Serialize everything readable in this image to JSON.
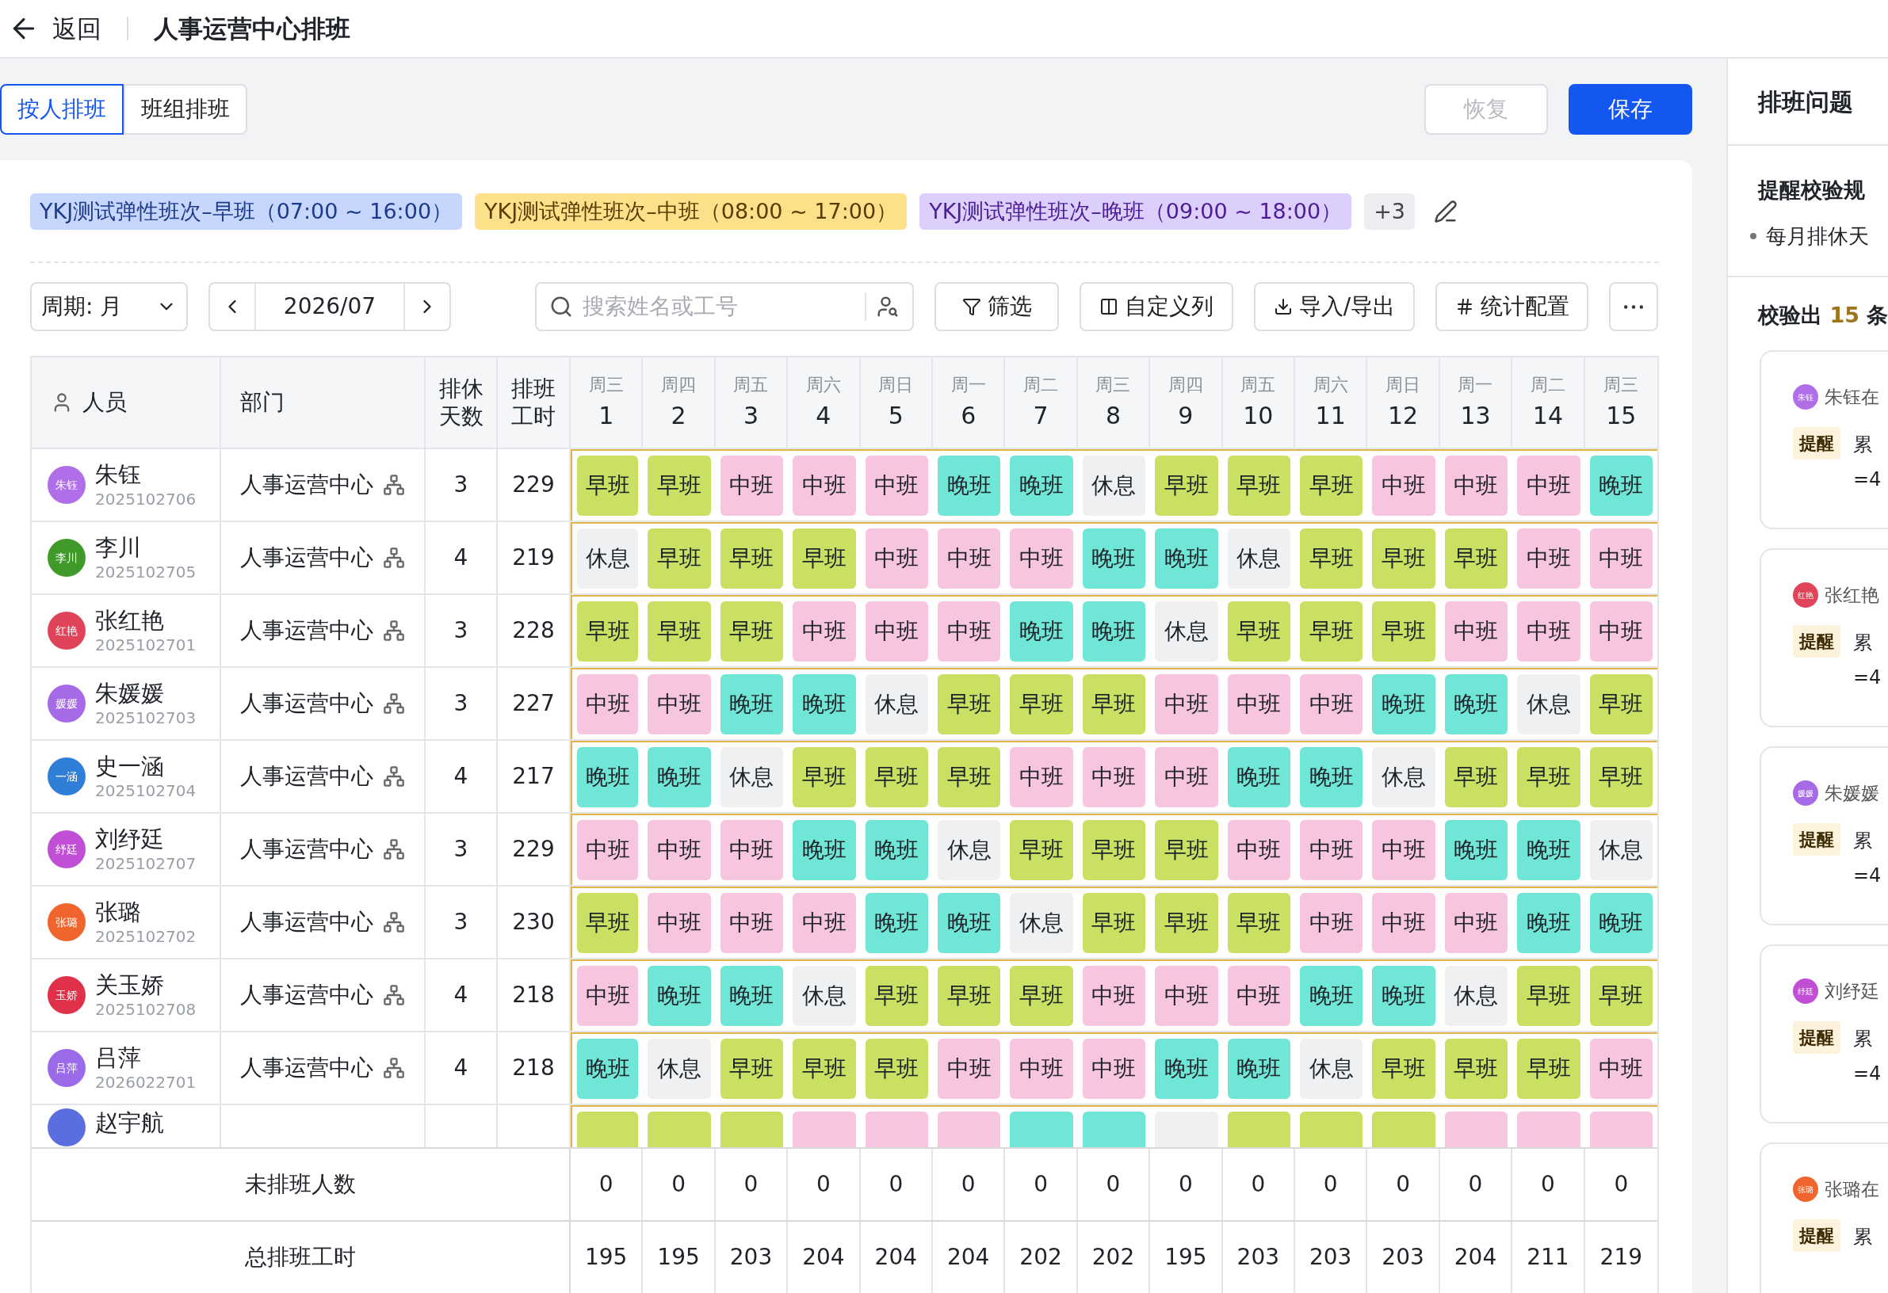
{
  "header": {
    "back": "返回",
    "title": "人事运营中心排班"
  },
  "tabs": [
    {
      "label": "按人排班",
      "selected": true
    },
    {
      "label": "班组排班",
      "selected": false
    }
  ],
  "actions": {
    "restore": {
      "label": "恢复",
      "disabled": true
    },
    "save": "保存"
  },
  "legend": [
    {
      "label": "YKJ测试弹性班次–早班（07:00 ~ 16:00）",
      "color": "#c6d6fd"
    },
    {
      "label": "YKJ测试弹性班次–中班（08:00 ~ 17:00）",
      "color": "#fce08a"
    },
    {
      "label": "YKJ测试弹性班次–晚班（09:00 ~ 18:00）",
      "color": "#dccffc"
    }
  ],
  "legend_more": "+3",
  "toolbar": {
    "period": "周期: 月",
    "month": "2026/07",
    "search_placeholder": "搜索姓名或工号",
    "filter": "筛选",
    "columns": "自定义列",
    "import_export": "导入/导出",
    "stats": "统计配置"
  },
  "table": {
    "columns": [
      "人员",
      "部门",
      "排休天数",
      "排班工时"
    ],
    "days": [
      {
        "weekday": "周三",
        "day": "1"
      },
      {
        "weekday": "周四",
        "day": "2"
      },
      {
        "weekday": "周五",
        "day": "3"
      },
      {
        "weekday": "周六",
        "day": "4"
      },
      {
        "weekday": "周日",
        "day": "5"
      },
      {
        "weekday": "周一",
        "day": "6"
      },
      {
        "weekday": "周二",
        "day": "7"
      },
      {
        "weekday": "周三",
        "day": "8"
      },
      {
        "weekday": "周四",
        "day": "9"
      },
      {
        "weekday": "周五",
        "day": "10"
      },
      {
        "weekday": "周六",
        "day": "11"
      },
      {
        "weekday": "周日",
        "day": "12"
      },
      {
        "weekday": "周一",
        "day": "13"
      },
      {
        "weekday": "周二",
        "day": "14"
      },
      {
        "weekday": "周三",
        "day": "15"
      }
    ],
    "rows": [
      {
        "name": "朱钰",
        "avatar": "朱钰",
        "color": "#b06ee8",
        "id": "2025102706",
        "dept": "人事运营中心",
        "rest": "3",
        "hours": "229",
        "shifts": [
          {
            "t": "早班",
            "kind": "early"
          },
          {
            "t": "早班",
            "kind": "early"
          },
          {
            "t": "中班",
            "kind": "mid"
          },
          {
            "t": "中班",
            "kind": "mid"
          },
          {
            "t": "中班",
            "kind": "mid"
          },
          {
            "t": "晚班",
            "kind": "late"
          },
          {
            "t": "晚班",
            "kind": "late"
          },
          {
            "t": "休息",
            "kind": "rest"
          },
          {
            "t": "早班",
            "kind": "early"
          },
          {
            "t": "早班",
            "kind": "early"
          },
          {
            "t": "早班",
            "kind": "early"
          },
          {
            "t": "中班",
            "kind": "mid"
          },
          {
            "t": "中班",
            "kind": "mid"
          },
          {
            "t": "中班",
            "kind": "mid"
          },
          {
            "t": "晚班",
            "kind": "late"
          }
        ]
      },
      {
        "name": "李川",
        "avatar": "李川",
        "color": "#3f9a2a",
        "id": "2025102705",
        "dept": "人事运营中心",
        "rest": "4",
        "hours": "219",
        "shifts": [
          {
            "t": "休息",
            "kind": "rest"
          },
          {
            "t": "早班",
            "kind": "early"
          },
          {
            "t": "早班",
            "kind": "early"
          },
          {
            "t": "早班",
            "kind": "early"
          },
          {
            "t": "中班",
            "kind": "mid"
          },
          {
            "t": "中班",
            "kind": "mid"
          },
          {
            "t": "中班",
            "kind": "mid"
          },
          {
            "t": "晚班",
            "kind": "late"
          },
          {
            "t": "晚班",
            "kind": "late"
          },
          {
            "t": "休息",
            "kind": "rest"
          },
          {
            "t": "早班",
            "kind": "early"
          },
          {
            "t": "早班",
            "kind": "early"
          },
          {
            "t": "早班",
            "kind": "early"
          },
          {
            "t": "中班",
            "kind": "mid"
          },
          {
            "t": "中班",
            "kind": "mid"
          }
        ]
      },
      {
        "name": "张红艳",
        "avatar": "红艳",
        "color": "#e0445a",
        "id": "2025102701",
        "dept": "人事运营中心",
        "rest": "3",
        "hours": "228",
        "shifts": [
          {
            "t": "早班",
            "kind": "early"
          },
          {
            "t": "早班",
            "kind": "early"
          },
          {
            "t": "早班",
            "kind": "early"
          },
          {
            "t": "中班",
            "kind": "mid"
          },
          {
            "t": "中班",
            "kind": "mid"
          },
          {
            "t": "中班",
            "kind": "mid"
          },
          {
            "t": "晚班",
            "kind": "late"
          },
          {
            "t": "晚班",
            "kind": "late"
          },
          {
            "t": "休息",
            "kind": "rest"
          },
          {
            "t": "早班",
            "kind": "early"
          },
          {
            "t": "早班",
            "kind": "early"
          },
          {
            "t": "早班",
            "kind": "early"
          },
          {
            "t": "中班",
            "kind": "mid"
          },
          {
            "t": "中班",
            "kind": "mid"
          },
          {
            "t": "中班",
            "kind": "mid"
          }
        ]
      },
      {
        "name": "朱媛媛",
        "avatar": "媛媛",
        "color": "#a66ae6",
        "id": "2025102703",
        "dept": "人事运营中心",
        "rest": "3",
        "hours": "227",
        "shifts": [
          {
            "t": "中班",
            "kind": "mid"
          },
          {
            "t": "中班",
            "kind": "mid"
          },
          {
            "t": "晚班",
            "kind": "late"
          },
          {
            "t": "晚班",
            "kind": "late"
          },
          {
            "t": "休息",
            "kind": "rest"
          },
          {
            "t": "早班",
            "kind": "early"
          },
          {
            "t": "早班",
            "kind": "early"
          },
          {
            "t": "早班",
            "kind": "early"
          },
          {
            "t": "中班",
            "kind": "mid"
          },
          {
            "t": "中班",
            "kind": "mid"
          },
          {
            "t": "中班",
            "kind": "mid"
          },
          {
            "t": "晚班",
            "kind": "late"
          },
          {
            "t": "晚班",
            "kind": "late"
          },
          {
            "t": "休息",
            "kind": "rest"
          },
          {
            "t": "早班",
            "kind": "early"
          }
        ]
      },
      {
        "name": "史一涵",
        "avatar": "一涵",
        "color": "#2f7fd8",
        "id": "2025102704",
        "dept": "人事运营中心",
        "rest": "4",
        "hours": "217",
        "shifts": [
          {
            "t": "晚班",
            "kind": "late"
          },
          {
            "t": "晚班",
            "kind": "late"
          },
          {
            "t": "休息",
            "kind": "rest"
          },
          {
            "t": "早班",
            "kind": "early"
          },
          {
            "t": "早班",
            "kind": "early"
          },
          {
            "t": "早班",
            "kind": "early"
          },
          {
            "t": "中班",
            "kind": "mid"
          },
          {
            "t": "中班",
            "kind": "mid"
          },
          {
            "t": "中班",
            "kind": "mid"
          },
          {
            "t": "晚班",
            "kind": "late"
          },
          {
            "t": "晚班",
            "kind": "late"
          },
          {
            "t": "休息",
            "kind": "rest"
          },
          {
            "t": "早班",
            "kind": "early"
          },
          {
            "t": "早班",
            "kind": "early"
          },
          {
            "t": "早班",
            "kind": "early"
          }
        ]
      },
      {
        "name": "刘纾廷",
        "avatar": "纾廷",
        "color": "#c04fd6",
        "id": "2025102707",
        "dept": "人事运营中心",
        "rest": "3",
        "hours": "229",
        "shifts": [
          {
            "t": "中班",
            "kind": "mid"
          },
          {
            "t": "中班",
            "kind": "mid"
          },
          {
            "t": "中班",
            "kind": "mid"
          },
          {
            "t": "晚班",
            "kind": "late"
          },
          {
            "t": "晚班",
            "kind": "late"
          },
          {
            "t": "休息",
            "kind": "rest"
          },
          {
            "t": "早班",
            "kind": "early"
          },
          {
            "t": "早班",
            "kind": "early"
          },
          {
            "t": "早班",
            "kind": "early"
          },
          {
            "t": "中班",
            "kind": "mid"
          },
          {
            "t": "中班",
            "kind": "mid"
          },
          {
            "t": "中班",
            "kind": "mid"
          },
          {
            "t": "晚班",
            "kind": "late"
          },
          {
            "t": "晚班",
            "kind": "late"
          },
          {
            "t": "休息",
            "kind": "rest"
          }
        ]
      },
      {
        "name": "张璐",
        "avatar": "张璐",
        "color": "#f0652e",
        "id": "2025102702",
        "dept": "人事运营中心",
        "rest": "3",
        "hours": "230",
        "shifts": [
          {
            "t": "早班",
            "kind": "early"
          },
          {
            "t": "中班",
            "kind": "mid"
          },
          {
            "t": "中班",
            "kind": "mid"
          },
          {
            "t": "中班",
            "kind": "mid"
          },
          {
            "t": "晚班",
            "kind": "late"
          },
          {
            "t": "晚班",
            "kind": "late"
          },
          {
            "t": "休息",
            "kind": "rest"
          },
          {
            "t": "早班",
            "kind": "early"
          },
          {
            "t": "早班",
            "kind": "early"
          },
          {
            "t": "早班",
            "kind": "early"
          },
          {
            "t": "中班",
            "kind": "mid"
          },
          {
            "t": "中班",
            "kind": "mid"
          },
          {
            "t": "中班",
            "kind": "mid"
          },
          {
            "t": "晚班",
            "kind": "late"
          },
          {
            "t": "晚班",
            "kind": "late"
          }
        ]
      },
      {
        "name": "关玉娇",
        "avatar": "玉娇",
        "color": "#e0304a",
        "id": "2025102708",
        "dept": "人事运营中心",
        "rest": "4",
        "hours": "218",
        "shifts": [
          {
            "t": "中班",
            "kind": "mid"
          },
          {
            "t": "晚班",
            "kind": "late"
          },
          {
            "t": "晚班",
            "kind": "late"
          },
          {
            "t": "休息",
            "kind": "rest"
          },
          {
            "t": "早班",
            "kind": "early"
          },
          {
            "t": "早班",
            "kind": "early"
          },
          {
            "t": "早班",
            "kind": "early"
          },
          {
            "t": "中班",
            "kind": "mid"
          },
          {
            "t": "中班",
            "kind": "mid"
          },
          {
            "t": "中班",
            "kind": "mid"
          },
          {
            "t": "晚班",
            "kind": "late"
          },
          {
            "t": "晚班",
            "kind": "late"
          },
          {
            "t": "休息",
            "kind": "rest"
          },
          {
            "t": "早班",
            "kind": "early"
          },
          {
            "t": "早班",
            "kind": "early"
          }
        ]
      },
      {
        "name": "吕萍",
        "avatar": "吕萍",
        "color": "#9a6ae8",
        "id": "2026022701",
        "dept": "人事运营中心",
        "rest": "4",
        "hours": "218",
        "shifts": [
          {
            "t": "晚班",
            "kind": "late"
          },
          {
            "t": "休息",
            "kind": "rest"
          },
          {
            "t": "早班",
            "kind": "early"
          },
          {
            "t": "早班",
            "kind": "early"
          },
          {
            "t": "早班",
            "kind": "early"
          },
          {
            "t": "中班",
            "kind": "mid"
          },
          {
            "t": "中班",
            "kind": "mid"
          },
          {
            "t": "中班",
            "kind": "mid"
          },
          {
            "t": "晚班",
            "kind": "late"
          },
          {
            "t": "晚班",
            "kind": "late"
          },
          {
            "t": "休息",
            "kind": "rest"
          },
          {
            "t": "早班",
            "kind": "early"
          },
          {
            "t": "早班",
            "kind": "early"
          },
          {
            "t": "早班",
            "kind": "early"
          },
          {
            "t": "中班",
            "kind": "mid"
          }
        ]
      },
      {
        "name": "赵宇航",
        "color": "#5b6ee0",
        "shifts": [
          {
            "kind": "early"
          },
          {
            "kind": "early"
          },
          {
            "kind": "early"
          },
          {
            "kind": "mid"
          },
          {
            "kind": "mid"
          },
          {
            "kind": "mid"
          },
          {
            "kind": "late"
          },
          {
            "kind": "late"
          },
          {
            "kind": "rest"
          },
          {
            "kind": "early"
          },
          {
            "kind": "early"
          },
          {
            "kind": "early"
          },
          {
            "kind": "mid"
          },
          {
            "kind": "mid"
          },
          {
            "kind": "mid"
          }
        ]
      }
    ],
    "footer": [
      {
        "label": "未排班人数",
        "values": [
          "0",
          "0",
          "0",
          "0",
          "0",
          "0",
          "0",
          "0",
          "0",
          "0",
          "0",
          "0",
          "0",
          "0",
          "0"
        ]
      },
      {
        "label": "总排班工时",
        "values": [
          "195",
          "195",
          "203",
          "204",
          "204",
          "204",
          "202",
          "202",
          "195",
          "203",
          "203",
          "203",
          "204",
          "211",
          "219"
        ]
      }
    ]
  },
  "issues": {
    "title": "排班问题",
    "rules_title": "提醒校验规",
    "rules": [
      "每月排休天"
    ],
    "summary_prefix": "校验出",
    "summary_count": "15",
    "summary_suffix": "条",
    "cards": [
      {
        "avatar": "朱钰",
        "color": "#b06ee8",
        "who": "朱钰在",
        "badge": "提醒",
        "text": "累",
        "extra": "=4"
      },
      {
        "avatar": "红艳",
        "color": "#e0445a",
        "who": "张红艳",
        "badge": "提醒",
        "text": "累",
        "extra": "=4"
      },
      {
        "avatar": "媛媛",
        "color": "#a66ae6",
        "who": "朱媛媛",
        "badge": "提醒",
        "text": "累",
        "extra": "=4"
      },
      {
        "avatar": "纾廷",
        "color": "#c04fd6",
        "who": "刘纾廷",
        "badge": "提醒",
        "text": "累",
        "extra": "=4"
      },
      {
        "avatar": "张璐",
        "color": "#f0652e",
        "who": "张璐在",
        "badge": "提醒",
        "text": "累"
      }
    ]
  }
}
